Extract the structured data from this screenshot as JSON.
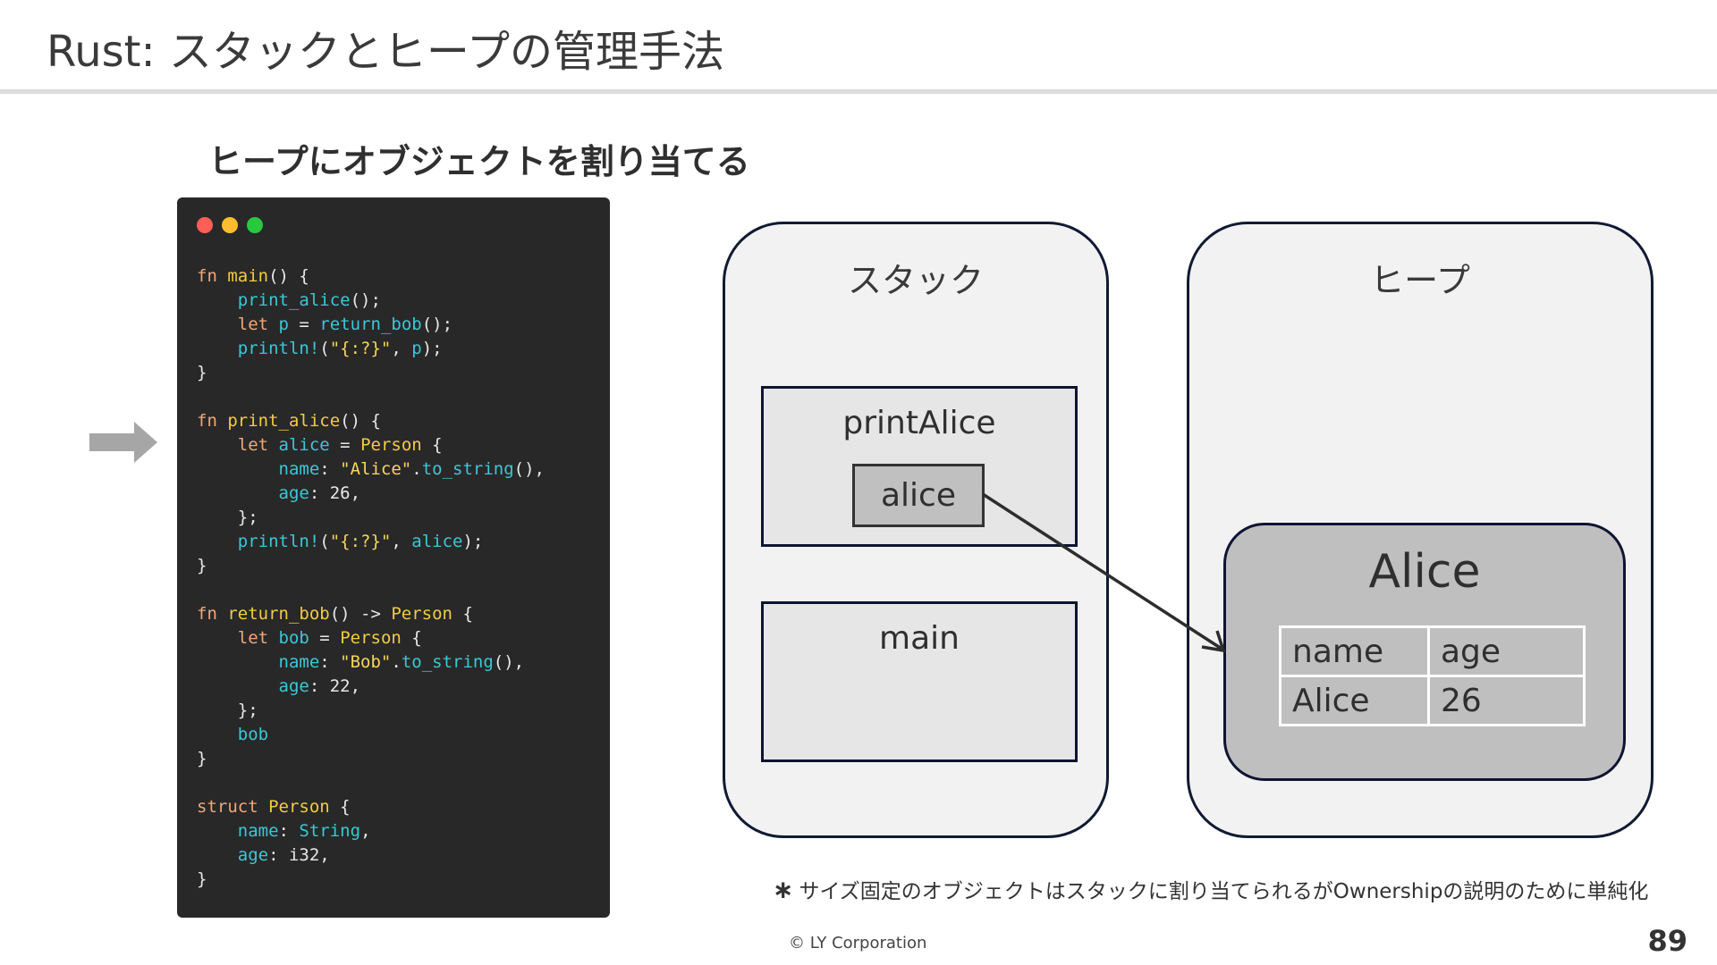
{
  "header": {
    "title": "Rust: スタックとヒープの管理手法"
  },
  "slide": {
    "subtitle": "ヒープにオブジェクトを割り当てる"
  },
  "code_window": {
    "dots": {
      "red": "#ff5f56",
      "yellow": "#ffbd2e",
      "green": "#27c93f"
    },
    "background": "#282828"
  },
  "code_lines": [
    [
      [
        "kw",
        "fn "
      ],
      [
        "fnn",
        "main"
      ],
      [
        "pl",
        "() {"
      ]
    ],
    [
      [
        "pl",
        "    "
      ],
      [
        "id",
        "print_alice"
      ],
      [
        "pl",
        "();"
      ]
    ],
    [
      [
        "pl",
        "    "
      ],
      [
        "kw",
        "let "
      ],
      [
        "id",
        "p"
      ],
      [
        "pl",
        " = "
      ],
      [
        "id",
        "return_bob"
      ],
      [
        "pl",
        "();"
      ]
    ],
    [
      [
        "pl",
        "    "
      ],
      [
        "id",
        "println!"
      ],
      [
        "pl",
        "("
      ],
      [
        "str",
        "\"{:?}\""
      ],
      [
        "pl",
        ", "
      ],
      [
        "id",
        "p"
      ],
      [
        "pl",
        ");"
      ]
    ],
    [
      [
        "pl",
        "}"
      ]
    ],
    [
      [
        "pl",
        ""
      ]
    ],
    [
      [
        "kw",
        "fn "
      ],
      [
        "fnn",
        "print_alice"
      ],
      [
        "pl",
        "() {"
      ]
    ],
    [
      [
        "pl",
        "    "
      ],
      [
        "kw",
        "let "
      ],
      [
        "id",
        "alice"
      ],
      [
        "pl",
        " = "
      ],
      [
        "ty",
        "Person"
      ],
      [
        "pl",
        " {"
      ]
    ],
    [
      [
        "pl",
        "        "
      ],
      [
        "id",
        "name"
      ],
      [
        "pl",
        ": "
      ],
      [
        "str",
        "\"Alice\""
      ],
      [
        "pl",
        "."
      ],
      [
        "id",
        "to_string"
      ],
      [
        "pl",
        "(),"
      ]
    ],
    [
      [
        "pl",
        "        "
      ],
      [
        "id",
        "age"
      ],
      [
        "pl",
        ": 26,"
      ]
    ],
    [
      [
        "pl",
        "    };"
      ]
    ],
    [
      [
        "pl",
        "    "
      ],
      [
        "id",
        "println!"
      ],
      [
        "pl",
        "("
      ],
      [
        "str",
        "\"{:?}\""
      ],
      [
        "pl",
        ", "
      ],
      [
        "id",
        "alice"
      ],
      [
        "pl",
        ");"
      ]
    ],
    [
      [
        "pl",
        "}"
      ]
    ],
    [
      [
        "pl",
        ""
      ]
    ],
    [
      [
        "kw",
        "fn "
      ],
      [
        "fnn",
        "return_bob"
      ],
      [
        "pl",
        "() -> "
      ],
      [
        "ty",
        "Person"
      ],
      [
        "pl",
        " {"
      ]
    ],
    [
      [
        "pl",
        "    "
      ],
      [
        "kw",
        "let "
      ],
      [
        "id",
        "bob"
      ],
      [
        "pl",
        " = "
      ],
      [
        "ty",
        "Person"
      ],
      [
        "pl",
        " {"
      ]
    ],
    [
      [
        "pl",
        "        "
      ],
      [
        "id",
        "name"
      ],
      [
        "pl",
        ": "
      ],
      [
        "str",
        "\"Bob\""
      ],
      [
        "pl",
        "."
      ],
      [
        "id",
        "to_string"
      ],
      [
        "pl",
        "(),"
      ]
    ],
    [
      [
        "pl",
        "        "
      ],
      [
        "id",
        "age"
      ],
      [
        "pl",
        ": 22,"
      ]
    ],
    [
      [
        "pl",
        "    };"
      ]
    ],
    [
      [
        "pl",
        "    "
      ],
      [
        "id",
        "bob"
      ]
    ],
    [
      [
        "pl",
        "}"
      ]
    ],
    [
      [
        "pl",
        ""
      ]
    ],
    [
      [
        "kw",
        "struct "
      ],
      [
        "ty",
        "Person"
      ],
      [
        "pl",
        " {"
      ]
    ],
    [
      [
        "pl",
        "    "
      ],
      [
        "id",
        "name"
      ],
      [
        "pl",
        ": "
      ],
      [
        "id",
        "String"
      ],
      [
        "pl",
        ","
      ]
    ],
    [
      [
        "pl",
        "    "
      ],
      [
        "id",
        "age"
      ],
      [
        "pl",
        ": i32,"
      ]
    ],
    [
      [
        "pl",
        "}"
      ]
    ]
  ],
  "stack": {
    "label": "スタック",
    "frames": [
      {
        "name": "printAlice",
        "variable": "alice"
      },
      {
        "name": "main"
      }
    ]
  },
  "heap": {
    "label": "ヒープ",
    "object": {
      "title": "Alice",
      "headers": [
        "name",
        "age"
      ],
      "values": [
        "Alice",
        "26"
      ]
    }
  },
  "footnote": {
    "mark": "∗",
    "text": "サイズ固定のオブジェクトはスタックに割り当てられるがOwnershipの説明のために単純化"
  },
  "footer": {
    "copyright": "© LY Corporation",
    "page": "89"
  },
  "colors": {
    "arrow": "#a6a6a6",
    "panel_border": "#111a33",
    "panel_fill": "#f2f2f2",
    "object_fill": "#bfbfbf"
  }
}
